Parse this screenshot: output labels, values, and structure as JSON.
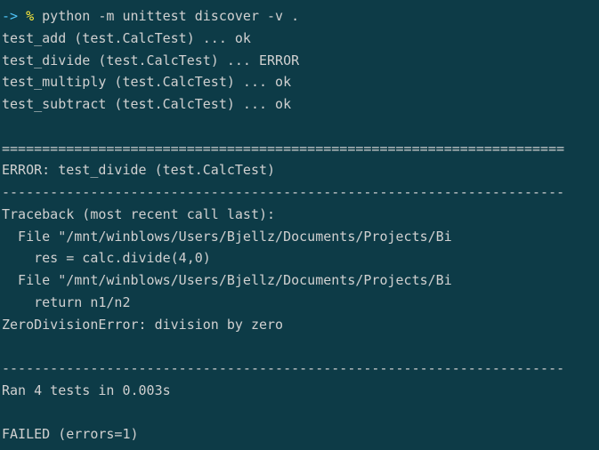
{
  "prompt": {
    "arrow": "->",
    "percent": "%",
    "command": "python -m unittest discover -v ."
  },
  "tests": [
    {
      "name": "test_add (test.CalcTest) ... ok"
    },
    {
      "name": "test_divide (test.CalcTest) ... ERROR"
    },
    {
      "name": "test_multiply (test.CalcTest) ... ok"
    },
    {
      "name": "test_subtract (test.CalcTest) ... ok"
    }
  ],
  "separator_eq": "======================================================================",
  "error_header": "ERROR: test_divide (test.CalcTest)",
  "separator_dash": "----------------------------------------------------------------------",
  "traceback": {
    "header": "Traceback (most recent call last):",
    "lines": [
      "  File \"/mnt/winblows/Users/Bjellz/Documents/Projects/Bi",
      "    res = calc.divide(4,0)",
      "  File \"/mnt/winblows/Users/Bjellz/Documents/Projects/Bi",
      "    return n1/n2"
    ],
    "exception": "ZeroDivisionError: division by zero"
  },
  "summary": {
    "ran": "Ran 4 tests in 0.003s",
    "result": "FAILED (errors=1)"
  }
}
